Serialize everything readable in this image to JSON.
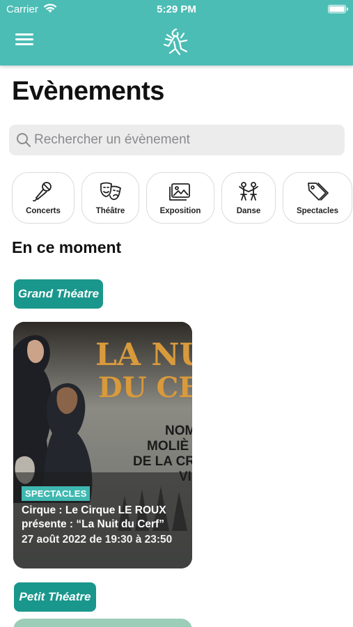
{
  "status_bar": {
    "carrier": "Carrier",
    "time": "5:29 PM"
  },
  "header": {
    "menu_icon": "hamburger-menu-icon",
    "logo_icon": "white-branch-figure-logo"
  },
  "page": {
    "title": "Evènements"
  },
  "search": {
    "placeholder": "Rechercher un évènement",
    "value": ""
  },
  "categories": [
    {
      "label": "Concerts",
      "icon": "microphone-icon"
    },
    {
      "label": "Théâtre",
      "icon": "theater-masks-icon"
    },
    {
      "label": "Exposition",
      "icon": "gallery-images-icon"
    },
    {
      "label": "Danse",
      "icon": "dancers-icon"
    },
    {
      "label": "Spectacles",
      "icon": "tags-icon"
    }
  ],
  "section": {
    "title": "En ce moment"
  },
  "venues": [
    {
      "name": "Grand Théatre",
      "events": [
        {
          "tag": "SPECTACLES",
          "title": "Cirque : Le Cirque LE ROUX présente : “La Nuit du Cerf”",
          "date": "27 août 2022 de 19:30 à 23:50",
          "poster_text": [
            "LA NU",
            "DU CE",
            "NOM",
            "MOLIÈ",
            "DE LA CR",
            "VI"
          ]
        }
      ]
    },
    {
      "name": "Petit Théatre",
      "events": []
    }
  ],
  "colors": {
    "header": "#4bbdb5",
    "venue_tag": "#1a978c",
    "category_tag": "#3fb8b0"
  }
}
